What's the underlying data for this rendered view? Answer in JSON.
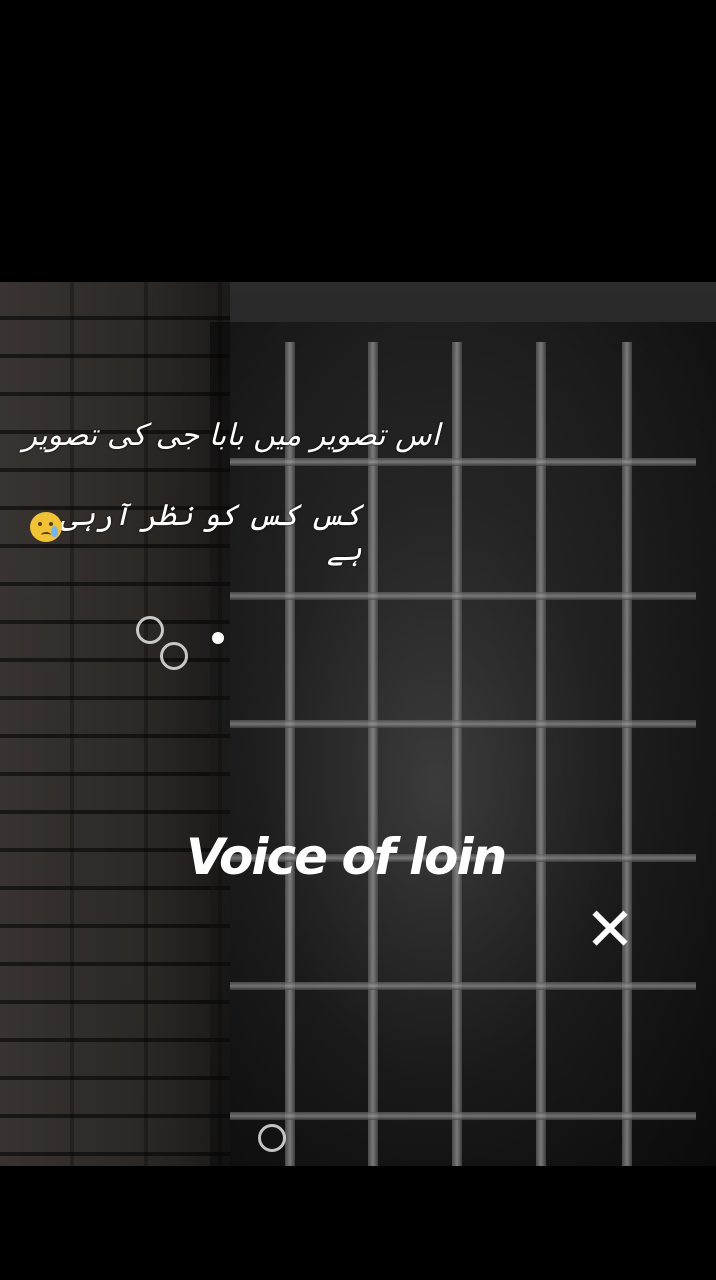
{
  "caption": {
    "line1": "اس تصویر میں بابا جی کی تصویر",
    "line2": "کس کس کو نظر آرہی ہے"
  },
  "emoji": "crying-face",
  "watermark": "Voice of loin",
  "close_symbol": "✕"
}
